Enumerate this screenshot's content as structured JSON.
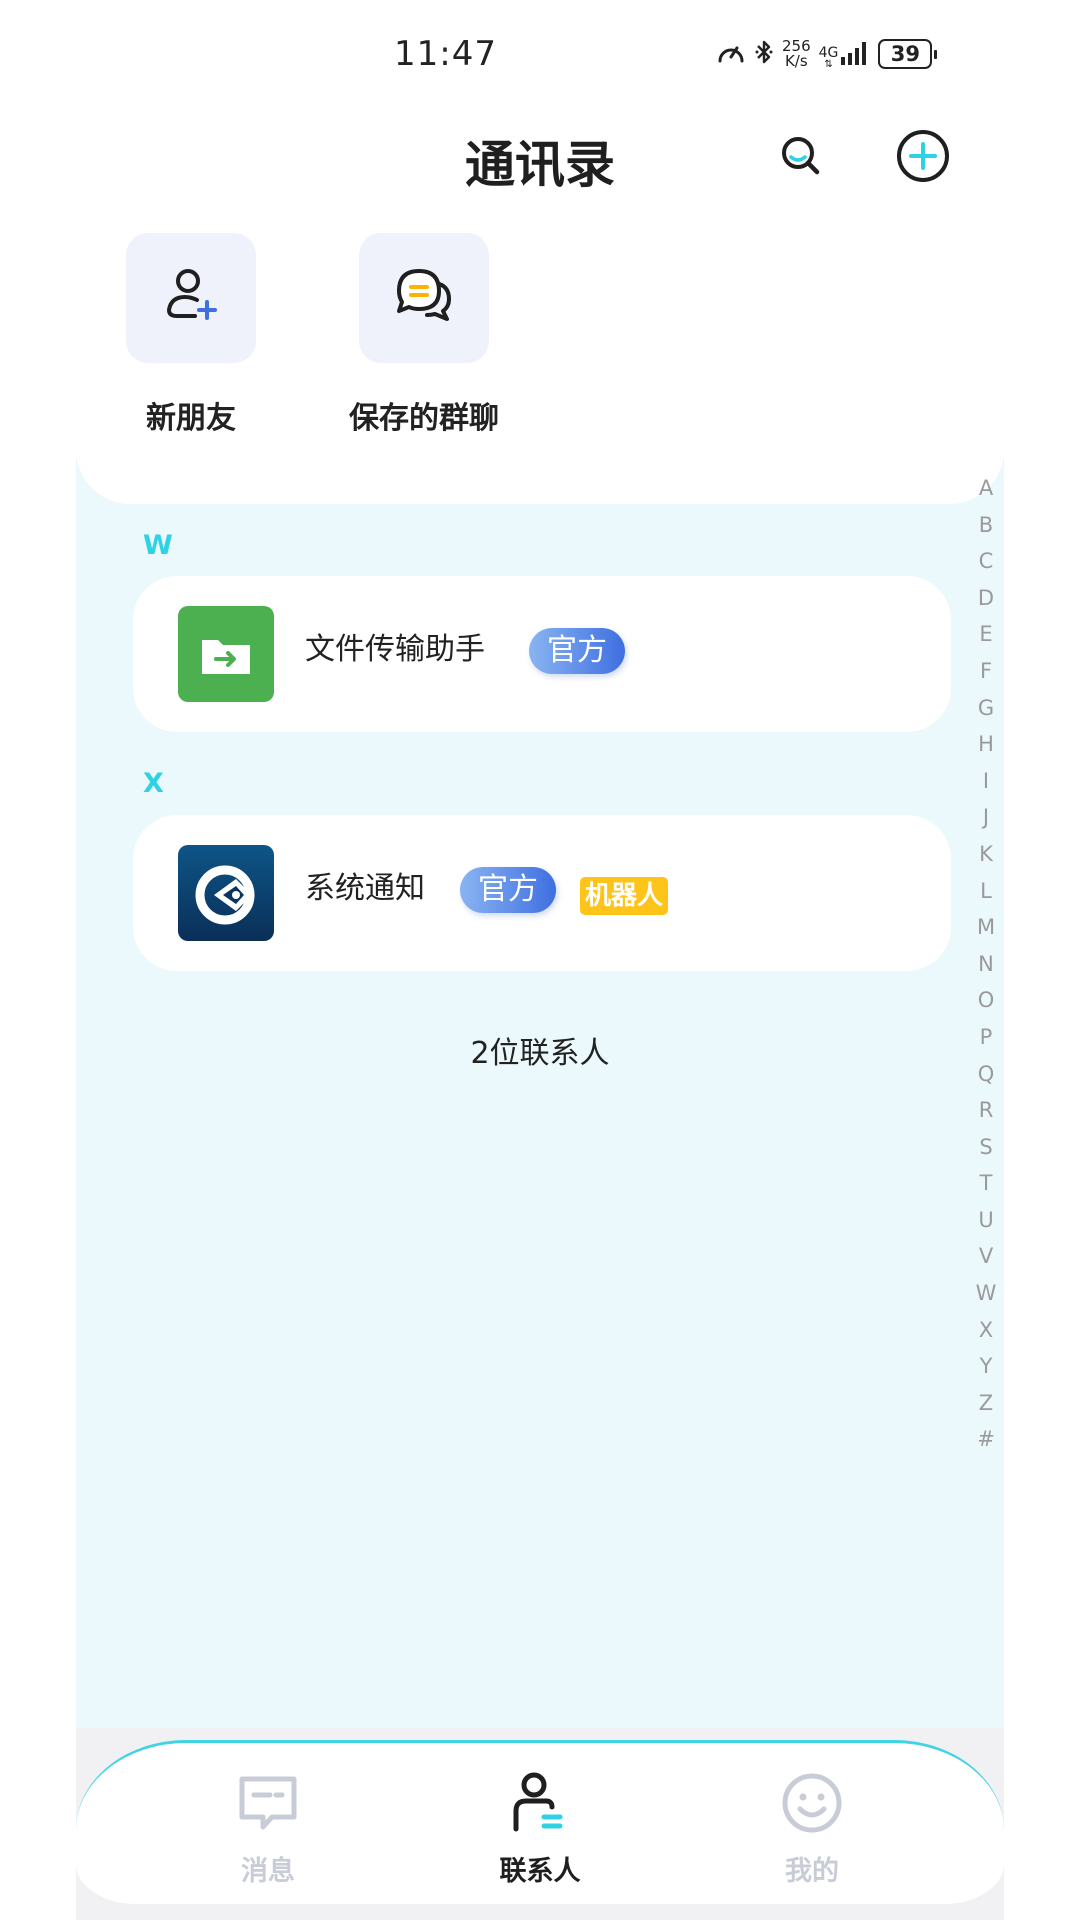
{
  "status_bar": {
    "time": "11:47",
    "net_speed_value": "256",
    "net_speed_unit": "K/s",
    "network_type": "4G",
    "battery": "39"
  },
  "header": {
    "title": "通讯录",
    "search_icon": "search-icon",
    "add_icon": "plus-circle-icon"
  },
  "shortcuts": [
    {
      "label": "新朋友",
      "icon": "add-user-icon"
    },
    {
      "label": "保存的群聊",
      "icon": "chat-bubbles-icon"
    }
  ],
  "sections": [
    {
      "letter": "W",
      "contacts": [
        {
          "name": "文件传输助手",
          "badges": [
            "官方"
          ],
          "icon": "file-transfer-icon",
          "color": "#4caf50"
        }
      ]
    },
    {
      "letter": "X",
      "contacts": [
        {
          "name": "系统通知",
          "badges": [
            "官方",
            "机器人"
          ],
          "icon": "system-notice-icon",
          "color": "#0b3f6e"
        }
      ]
    }
  ],
  "contact_count": "2位联系人",
  "alphabet": [
    "A",
    "B",
    "C",
    "D",
    "E",
    "F",
    "G",
    "H",
    "I",
    "J",
    "K",
    "L",
    "M",
    "N",
    "O",
    "P",
    "Q",
    "R",
    "S",
    "T",
    "U",
    "V",
    "W",
    "X",
    "Y",
    "Z",
    "#"
  ],
  "tabs": [
    {
      "label": "消息",
      "icon": "message-icon",
      "active": false
    },
    {
      "label": "联系人",
      "icon": "contacts-icon",
      "active": true
    },
    {
      "label": "我的",
      "icon": "smile-icon",
      "active": false
    }
  ],
  "colors": {
    "accent": "#2ed2e4",
    "official_badge": "#3f6fe0",
    "bot_badge": "#ffc419",
    "panel_bg": "#ebf9fc"
  }
}
